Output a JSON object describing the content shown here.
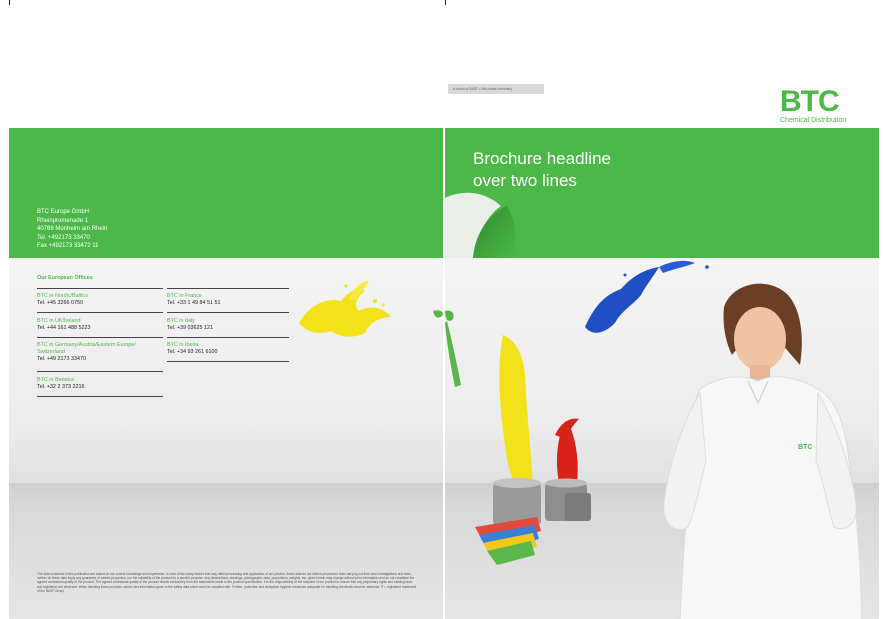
{
  "left_page": {
    "address": {
      "company": "BTC Europe GmbH",
      "street": "Rheinpromenade 1",
      "city": "40789 Monheim am Rhein",
      "tel": "Tel. +492173 33470",
      "fax": "Fax +492173 33472 11"
    },
    "offices_title": "Our European Offices",
    "offices": [
      {
        "name": "BTC in Nordic/Baltics",
        "tel": "Tel. +45 3266 0750"
      },
      {
        "name": "BTC in UK/Ireland",
        "tel": "Tel. +44 161 488 5223"
      },
      {
        "name": "BTC in Germany/Austria/Eastern Europe/ Switzerland",
        "tel": "Tel. +49 2173 33470"
      },
      {
        "name": "BTC in Benelux",
        "tel": "Tel. +32 2 373 2216"
      },
      {
        "name": "BTC in France",
        "tel": "Tel. +33 1 49 84 51 51"
      },
      {
        "name": "BTC in Italy",
        "tel": "Tel. +39 03625 121"
      },
      {
        "name": "BTC in Iberia",
        "tel": "Tel. +34 93 261 6100"
      }
    ],
    "disclaimer": "The data contained in this publication are based on our current knowledge and experience. In view of the many factors that may affect processing and application of our product, these data do not relieve processors from carrying out their own investigations and tests; neither do these data imply any guarantee of certain properties, nor the suitability of the product for a specific purpose. Any descriptions, drawings, photographs, data, proportions, weights, etc. given herein may change without prior information and do not constitute the agreed contractual quality of the product. The agreed contractual quality of the product results exclusively from the statements made in the product specification. It is the responsibility of the recipient of our product to ensure that any proprietary rights and existing laws and legislation are observed. When handling these products, advice and information given in the safety data sheet must be complied with. Further, protective and workplace hygiene measures adequate for handling chemicals must be observed. ® = registered trademark of the BASF Group"
  },
  "right_page": {
    "basf_tag": "A brand of BASF • We create chemistry",
    "logo_text": "BTC",
    "logo_sub": "Chemical Distribution",
    "headline_line1": "Brochure headline",
    "headline_line2": "over two lines",
    "shirt_logo": "BTC"
  },
  "colors": {
    "brand_green": "#4cb848",
    "paint_yellow": "#f2e21a",
    "paint_blue": "#1f4fc4",
    "paint_red": "#d8231a"
  }
}
